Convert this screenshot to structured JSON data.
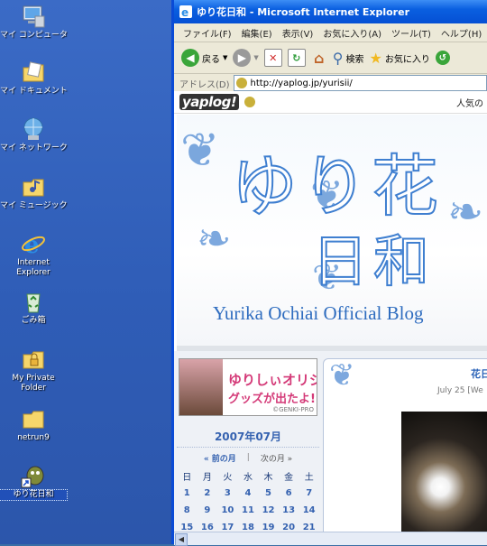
{
  "desktop": {
    "icons": [
      {
        "label": "マイ コンピュータ",
        "icon": "computer-icon"
      },
      {
        "label": "マイ ドキュメント",
        "icon": "documents-folder-icon"
      },
      {
        "label": "マイ ネットワーク",
        "icon": "network-icon"
      },
      {
        "label": "マイ ミュージック",
        "icon": "music-folder-icon"
      },
      {
        "label": "Internet Explorer",
        "icon": "internet-explorer-icon"
      },
      {
        "label": "ごみ箱",
        "icon": "recycle-bin-icon"
      },
      {
        "label": "My Private Folder",
        "icon": "private-folder-icon"
      },
      {
        "label": "netrun9",
        "icon": "folder-icon"
      },
      {
        "label": "ゆり花日和",
        "icon": "shortcut-icon"
      }
    ]
  },
  "browser": {
    "title": "ゆり花日和 - Microsoft Internet Explorer",
    "menu": [
      "ファイル(F)",
      "編集(E)",
      "表示(V)",
      "お気に入り(A)",
      "ツール(T)",
      "ヘルプ(H)"
    ],
    "toolbar": {
      "back": "戻る",
      "search": "検索",
      "favorites": "お気に入り"
    },
    "address_label": "アドレス(D)",
    "url": "http://yaplog.jp/yurisii/"
  },
  "page": {
    "logo": "yaplog!",
    "nav_text": "人気の",
    "banner": {
      "title_line1": "ゆり花",
      "title_line2": "日和",
      "subtitle": "Yurika Ochiai Official Blog"
    },
    "promo": {
      "line1": "ゆりしぃオリジナル",
      "line2": "グッズが出たよ!!",
      "credit": "©GENKI-PRO"
    },
    "calendar": {
      "month": "2007年07月",
      "prev": "« 前の月",
      "sep": "|",
      "next": "次の月 »",
      "weekdays": [
        "日",
        "月",
        "火",
        "水",
        "木",
        "金",
        "土"
      ],
      "rows": [
        [
          "1",
          "2",
          "3",
          "4",
          "5",
          "6",
          "7"
        ],
        [
          "8",
          "9",
          "10",
          "11",
          "12",
          "13",
          "14"
        ],
        [
          "15",
          "16",
          "17",
          "18",
          "19",
          "20",
          "21"
        ]
      ]
    },
    "post": {
      "title": "花日",
      "date": "July 25 [We"
    }
  }
}
